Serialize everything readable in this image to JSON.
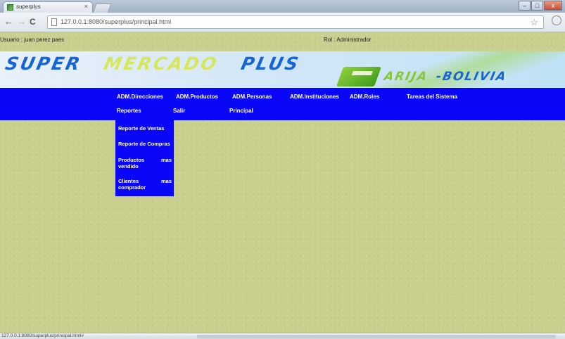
{
  "browser": {
    "tab_title": "superplus",
    "tab_close": "×",
    "back": "←",
    "forward": "→",
    "reload": "C",
    "url": "127.0.0.1:8080/superplus/principal.html",
    "star": "☆",
    "window_buttons": {
      "minimize": "–",
      "maximize": "□",
      "close": "x"
    }
  },
  "header": {
    "user": "Usuario : juan perez paes",
    "role": "Rol : Administrador"
  },
  "banner": {
    "word1": "SUPER",
    "word2": "MERCADO",
    "word3": "PLUS",
    "word4": "ARIJA",
    "word5": "-BOLIVIA"
  },
  "menu": {
    "row1": [
      "ADM.Direcciones",
      "ADM.Productos",
      "ADM.Personas",
      "ADM.Instituciones",
      "ADM.Roles",
      "Tareas del Sistema"
    ],
    "row2": [
      "Reportes",
      "Salir",
      "Principal"
    ]
  },
  "submenu": {
    "items": [
      {
        "label": "Reporte de Ventas"
      },
      {
        "label": "Reporte de Compras"
      },
      {
        "label": "Productos vendido",
        "line1": "Productos",
        "line2": "vendido",
        "suffix": "mas"
      },
      {
        "label": "Clientes comprador",
        "line1": "Clientes",
        "line2": "comprador",
        "suffix": "mas"
      }
    ]
  },
  "status": {
    "url": "127.0.0.1:8080/superplus/principal.html#"
  }
}
